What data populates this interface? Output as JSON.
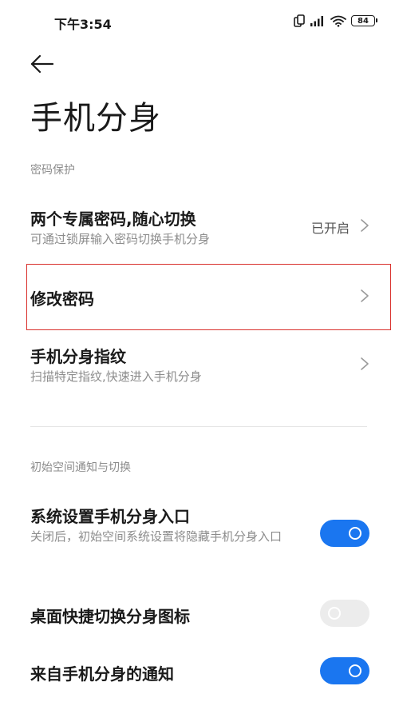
{
  "status_bar": {
    "time": "下午3:54",
    "battery": "84",
    "icons": [
      "vibrate-icon",
      "signal-icon",
      "wifi-icon",
      "battery-icon"
    ]
  },
  "header": {
    "back_icon": "arrow-left-icon",
    "title": "手机分身"
  },
  "sections": {
    "password": {
      "header": "密码保护",
      "items": [
        {
          "title": "两个专属密码,随心切换",
          "subtitle": "可通过锁屏输入密码切换手机分身",
          "value": "已开启"
        },
        {
          "title": "修改密码"
        },
        {
          "title": "手机分身指纹",
          "subtitle": "扫描特定指纹,快速进入手机分身"
        }
      ]
    },
    "initial_space": {
      "header": "初始空间通知与切换",
      "items": [
        {
          "title": "系统设置手机分身入口",
          "subtitle": "关闭后，初始空间系统设置将隐藏手机分身入口",
          "toggle_on": true
        },
        {
          "title": "桌面快捷切换分身图标",
          "toggle_on": false
        },
        {
          "title": "来自手机分身的通知",
          "toggle_on": true
        }
      ]
    }
  },
  "colors": {
    "toggle_on": "#1a76f0",
    "toggle_off": "#ececec",
    "highlight_border": "#d9302c",
    "secondary_text": "#8c8c8c"
  }
}
